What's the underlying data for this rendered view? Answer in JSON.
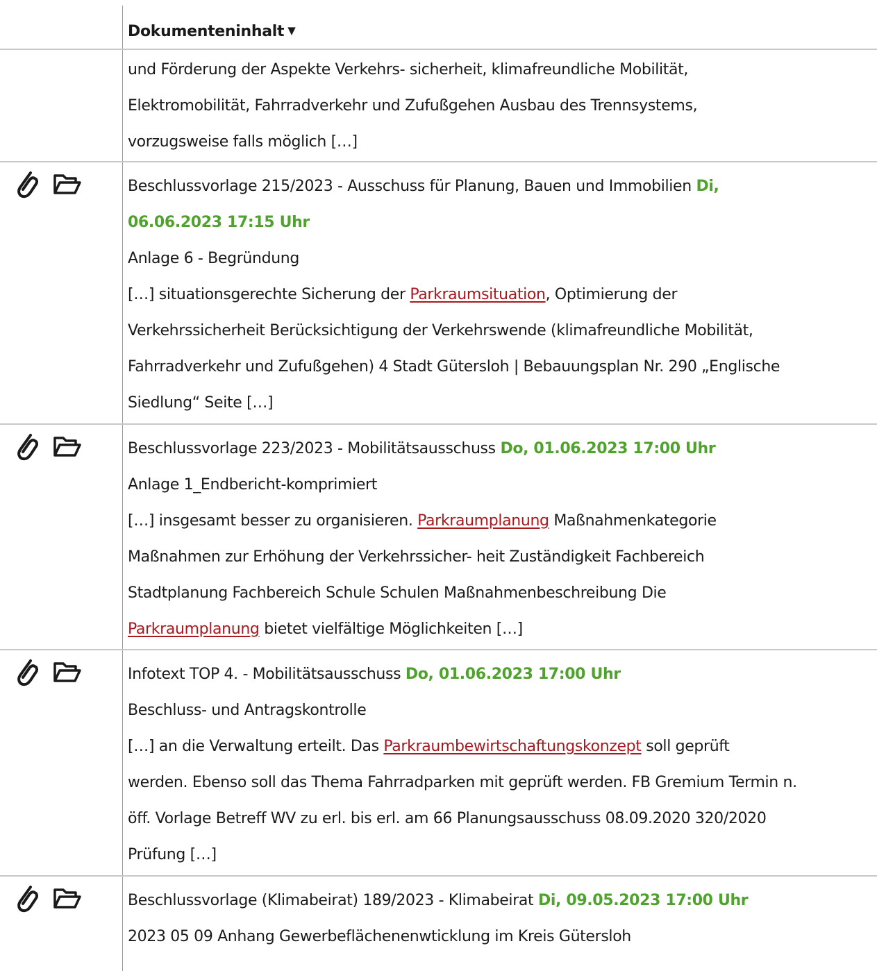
{
  "header": {
    "label": "Dokumenteninhalt",
    "caret": "▼"
  },
  "colors": {
    "date": "#4fa22d",
    "highlight": "#a7191e",
    "border": "#c8c8c8"
  },
  "rows": [
    {
      "snippet": {
        "l1": "und Förderung der Aspekte Verkehrs- sicherheit, klimafreundliche Mobilität,",
        "l2": "Elektromobilität, Fahrradverkehr und Zufußgehen Ausbau des Trennsystems,",
        "l3": "vorzugsweise falls möglich […]"
      }
    },
    {
      "title": "Beschlussvorlage 215/2023 - Ausschuss für Planung, Bauen und Immobilien ",
      "date_a": "Di,",
      "date_b": "06.06.2023 17:15 Uhr",
      "doc": "Anlage 6 - Begründung",
      "snippet": {
        "l1_pre": "[…] situationsgerechte Sicherung der ",
        "l1_hl": "Parkraumsituation",
        "l1_post": ", Optimierung der",
        "l2": "Verkehrssicherheit Berücksichtigung der Verkehrswende (klimafreundliche Mobilität,",
        "l3": "Fahrradverkehr und Zufußgehen) 4 Stadt Gütersloh | Bebauungsplan Nr. 290 „Englische",
        "l4": "Siedlung“ Seite […]"
      }
    },
    {
      "title": "Beschlussvorlage 223/2023 - Mobilitätsausschuss ",
      "date": "Do, 01.06.2023 17:00 Uhr",
      "doc": "Anlage 1_Endbericht-komprimiert",
      "snippet": {
        "l1_pre": "[…] insgesamt besser zu organisieren. ",
        "l1_hl": "Parkraumplanung",
        "l1_post": " Maßnahmenkategorie",
        "l2": "Maßnahmen zur Erhöhung der Verkehrssicher- heit Zuständigkeit Fachbereich",
        "l3": "Stadtplanung Fachbereich Schule Schulen Maßnahmenbeschreibung Die",
        "l4_hl": "Parkraumplanung",
        "l4_post": " bietet vielfältige Möglichkeiten […]"
      }
    },
    {
      "title": "Infotext TOP 4. - Mobilitätsausschuss ",
      "date": "Do, 01.06.2023 17:00 Uhr",
      "doc": "Beschluss- und Antragskontrolle",
      "snippet": {
        "l1_pre": "[…] an die Verwaltung erteilt. Das ",
        "l1_hl": "Parkraumbewirtschaftungskonzept",
        "l1_post": " soll geprüft",
        "l2": "werden. Ebenso soll das Thema Fahrradparken mit geprüft werden. FB Gremium Termin n.",
        "l3": "öff. Vorlage Betreff WV zu erl. bis erl. am 66 Planungsausschuss 08.09.2020 320/2020",
        "l4": "Prüfung […]"
      }
    },
    {
      "title": "Beschlussvorlage (Klimabeirat) 189/2023 - Klimabeirat ",
      "date": "Di, 09.05.2023 17:00 Uhr",
      "doc": "2023 05 09 Anhang Gewerbeflächenenwticklung im Kreis Gütersloh"
    }
  ]
}
